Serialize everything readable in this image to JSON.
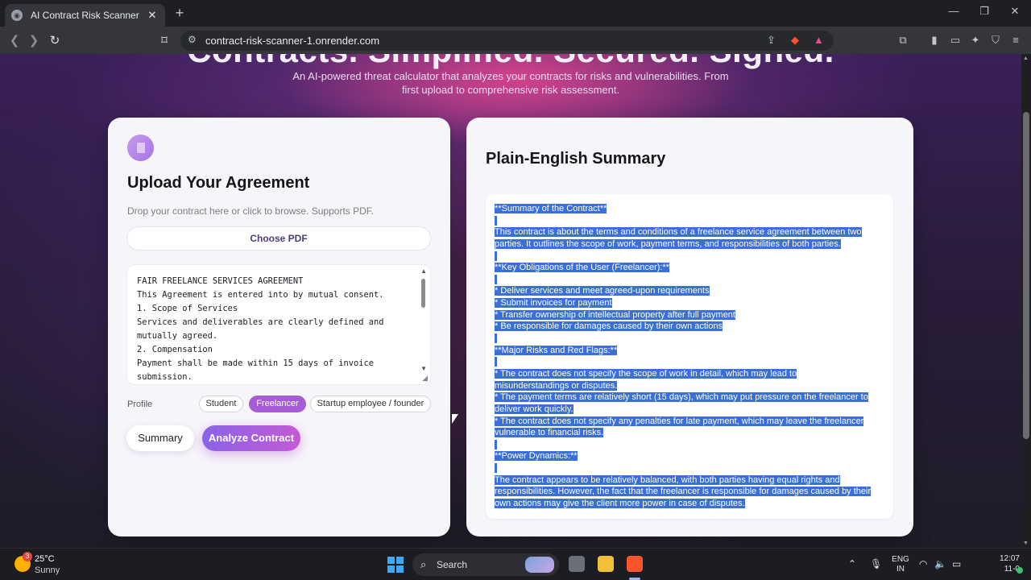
{
  "browser": {
    "tab_title": "AI Contract Risk Scanner",
    "url": "contract-risk-scanner-1.onrender.com"
  },
  "hero": {
    "title": "Contracts. Simplified. Secured. Signed.",
    "subtitle": "An AI-powered threat calculator that analyzes your contracts for risks and vulnerabilities. From first upload to comprehensive risk assessment."
  },
  "upload": {
    "title": "Upload Your Agreement",
    "hint": "Drop your contract here or click to browse. Supports PDF.",
    "choose_label": "Choose PDF",
    "contract_text": "FAIR FREELANCE SERVICES AGREEMENT\nThis Agreement is entered into by mutual consent.\n1. Scope of Services\nServices and deliverables are clearly defined and\nmutually agreed.\n2. Compensation\nPayment shall be made within 15 days of invoice\nsubmission.",
    "profile_label": "Profile",
    "profiles": [
      "Student",
      "Freelancer",
      "Startup employee / founder"
    ],
    "selected_profile": "Freelancer",
    "summary_label": "Summary",
    "analyze_label": "Analyze Contract"
  },
  "summary": {
    "heading": "Plain-English Summary",
    "lines": [
      "**Summary of the Contract**",
      "",
      "This contract is about the terms and conditions of a freelance service agreement between two",
      "parties. It outlines the scope of work, payment terms, and responsibilities of both parties.",
      "",
      "**Key Obligations of the User (Freelancer):**",
      "",
      "* Deliver services and meet agreed-upon requirements",
      "* Submit invoices for payment",
      "* Transfer ownership of intellectual property after full payment",
      "* Be responsible for damages caused by their own actions",
      "",
      "**Major Risks and Red Flags:**",
      "",
      "* The contract does not specify the scope of work in detail, which may lead to",
      "misunderstandings or disputes.",
      "* The payment terms are relatively short (15 days), which may put pressure on the freelancer to",
      "deliver work quickly.",
      "* The contract does not specify any penalties for late payment, which may leave the freelancer",
      "vulnerable to financial risks.",
      "",
      "**Power Dynamics:**",
      "",
      "The contract appears to be relatively balanced, with both parties having equal rights and",
      "responsibilities. However, the fact that the freelancer is responsible for damages caused by their",
      "own actions may give the client more power in case of disputes."
    ]
  },
  "taskbar": {
    "weather_temp": "25°C",
    "weather_desc": "Sunny",
    "weather_badge": "3",
    "search_label": "Search",
    "lang_top": "ENG",
    "lang_bottom": "IN",
    "time": "12:07",
    "date": "11-0"
  },
  "colors": {
    "accent": "#a65cd6",
    "selection": "#3a6fd8",
    "analyze_gradient_start": "#8a63e8",
    "analyze_gradient_end": "#c45ad4"
  }
}
